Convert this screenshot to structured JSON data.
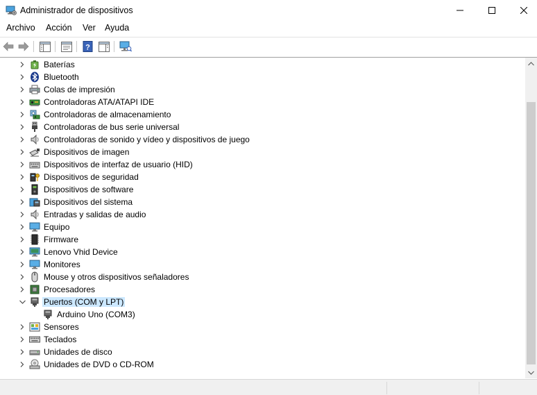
{
  "window": {
    "title": "Administrador de dispositivos",
    "app_icon": "device-manager-icon"
  },
  "menu": [
    "Archivo",
    "Acción",
    "Ver",
    "Ayuda"
  ],
  "toolbar": {
    "buttons": [
      "back-arrow-icon",
      "forward-arrow-icon",
      "show-hide-console-tree-icon",
      "properties-icon",
      "help-icon",
      "action-pane-icon",
      "scan-hardware-icon"
    ]
  },
  "tree": [
    {
      "label": "Baterías",
      "icon": "battery-icon",
      "state": "collapsed"
    },
    {
      "label": "Bluetooth",
      "icon": "bluetooth-icon",
      "state": "collapsed"
    },
    {
      "label": "Colas de impresión",
      "icon": "printer-icon",
      "state": "collapsed"
    },
    {
      "label": "Controladoras ATA/ATAPI IDE",
      "icon": "ide-controller-icon",
      "state": "collapsed"
    },
    {
      "label": "Controladoras de almacenamiento",
      "icon": "storage-controller-icon",
      "state": "collapsed"
    },
    {
      "label": "Controladoras de bus serie universal",
      "icon": "usb-icon",
      "state": "collapsed"
    },
    {
      "label": "Controladoras de sonido y vídeo y dispositivos de juego",
      "icon": "speaker-icon",
      "state": "collapsed"
    },
    {
      "label": "Dispositivos de imagen",
      "icon": "camera-icon",
      "state": "collapsed"
    },
    {
      "label": "Dispositivos de interfaz de usuario (HID)",
      "icon": "hid-keyboard-icon",
      "state": "collapsed"
    },
    {
      "label": "Dispositivos de seguridad",
      "icon": "security-key-icon",
      "state": "collapsed"
    },
    {
      "label": "Dispositivos de software",
      "icon": "software-device-icon",
      "state": "collapsed"
    },
    {
      "label": "Dispositivos del sistema",
      "icon": "system-folder-icon",
      "state": "collapsed"
    },
    {
      "label": "Entradas y salidas de audio",
      "icon": "audio-io-icon",
      "state": "collapsed"
    },
    {
      "label": "Equipo",
      "icon": "computer-monitor-icon",
      "state": "collapsed"
    },
    {
      "label": "Firmware",
      "icon": "firmware-chip-icon",
      "state": "collapsed"
    },
    {
      "label": "Lenovo Vhid Device",
      "icon": "network-monitor-icon",
      "state": "collapsed"
    },
    {
      "label": "Monitores",
      "icon": "monitor-icon",
      "state": "collapsed"
    },
    {
      "label": "Mouse y otros dispositivos señaladores",
      "icon": "mouse-icon",
      "state": "collapsed"
    },
    {
      "label": "Procesadores",
      "icon": "processor-icon",
      "state": "collapsed"
    },
    {
      "label": "Puertos (COM y LPT)",
      "icon": "port-icon",
      "state": "expanded",
      "selected": true
    },
    {
      "label": "Arduino Uno (COM3)",
      "icon": "port-icon",
      "state": "leaf",
      "child": true
    },
    {
      "label": "Sensores",
      "icon": "sensor-icon",
      "state": "collapsed"
    },
    {
      "label": "Teclados",
      "icon": "keyboard-icon",
      "state": "collapsed"
    },
    {
      "label": "Unidades de disco",
      "icon": "disk-drive-icon",
      "state": "collapsed"
    },
    {
      "label": "Unidades de DVD o CD-ROM",
      "icon": "dvd-drive-icon",
      "state": "collapsed"
    }
  ],
  "colors": {
    "selection": "#cce8ff",
    "expander": "#404040",
    "scrollbar_track": "#f0f0f0",
    "scrollbar_thumb": "#cdcdcd"
  }
}
